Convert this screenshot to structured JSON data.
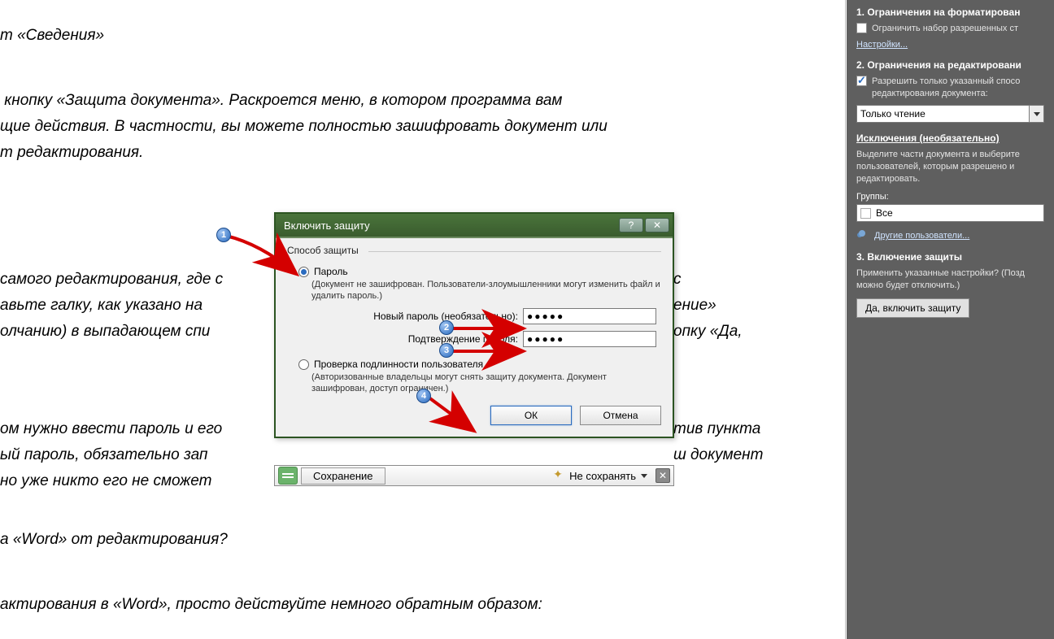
{
  "doc": {
    "line1": "т «Сведения»",
    "line2": " кнопку «Защита документа». Раскроется меню, в котором программа вам",
    "line3": "щие действия. В частности, вы можете полностью зашифровать документ или",
    "line4": "т редактирования.",
    "line5": "самого редактирования, где с",
    "line5b": "с",
    "line6": "авьте галку, как указано на",
    "line6b": "ение»",
    "line7": "олчанию) в выпадающем спи",
    "line7b": "опку «Да,",
    "line8": "ом нужно ввести пароль и его",
    "line8b": "тив пункта",
    "line9": "ый пароль, обязательно зап",
    "line9b": "ш документ",
    "line10": "но уже никто его не сможет",
    "line11": "а «Word» от редактирования?",
    "line12": "актирования в «Word», просто действуйте немного обратным образом:"
  },
  "dialog": {
    "title": "Включить защиту",
    "group_label": "Способ защиты",
    "radio_password": "Пароль",
    "radio_password_desc": "(Документ не зашифрован. Пользователи-злоумышленники могут изменить файл и удалить пароль.)",
    "pw_new_label": "Новый пароль (необязательно):",
    "pw_confirm_label": "Подтверждение пароля:",
    "pw_value1": "●●●●●",
    "pw_value2": "●●●●●",
    "radio_auth": "Проверка подлинности пользователя",
    "radio_auth_desc": "(Авторизованные владельцы могут снять защиту документа. Документ зашифрован, доступ ограничен.)",
    "ok": "ОК",
    "cancel": "Отмена"
  },
  "status": {
    "save": "Сохранение",
    "nosave": "Не сохранять"
  },
  "pane": {
    "sec1_title": "1. Ограничения на форматирован",
    "sec1_chk": "Ограничить набор разрешенных ст",
    "sec1_link": "Настройки...",
    "sec2_title": "2. Ограничения на редактировани",
    "sec2_chk": "Разрешить только указанный спосо редактирования документа:",
    "sec2_select": "Только чтение",
    "exc_title": "Исключения (необязательно)",
    "exc_text": "Выделите части документа и выберите пользователей, которым разрешено и редактировать.",
    "groups_label": "Группы:",
    "groups_item": "Все",
    "more_users": "Другие пользователи...",
    "sec3_title": "3. Включение защиты",
    "sec3_text": "Применить указанные настройки? (Позд можно будет отключить.)",
    "sec3_btn": "Да, включить защиту"
  },
  "badges": {
    "b1": "1",
    "b2": "2",
    "b3": "3",
    "b4": "4"
  }
}
